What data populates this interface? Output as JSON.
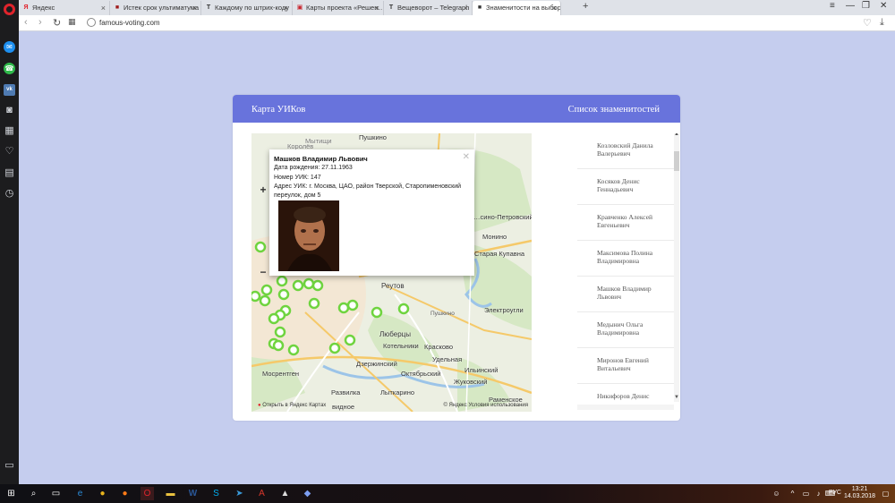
{
  "browser": {
    "tabs": [
      {
        "label": "Яндекс",
        "icon": "yandex-favicon",
        "icon_glyph": "Я",
        "color": "#e0242c"
      },
      {
        "label": "Истек срок ультиматумa",
        "icon": "news-favicon",
        "icon_glyph": "■",
        "color": "#a01c1c"
      },
      {
        "label": "Каждому по штрих-коду",
        "icon": "telegraph-favicon",
        "icon_glyph": "T",
        "color": "#222222"
      },
      {
        "label": "Карты проекта «Решен…",
        "icon": "project-favicon",
        "icon_glyph": "▣",
        "color": "#c8232c"
      },
      {
        "label": "Вещеворот – Telegraph",
        "icon": "telegraph-favicon",
        "icon_glyph": "T",
        "color": "#222222"
      },
      {
        "label": "Знаменитости на выбор…",
        "icon": "page-favicon",
        "icon_glyph": "■",
        "color": "#333333"
      }
    ],
    "url": "famous-voting.com"
  },
  "card": {
    "tab_map": "Карта УИКов",
    "tab_list": "Список знаменитостей",
    "accent": "#6873dc"
  },
  "map": {
    "labels": [
      "Пушкино",
      "Королёв",
      "Мытищи",
      "…сино-Петровский",
      "Монино",
      "Старая Купавна",
      "Реутов",
      "Пушкино",
      "Электроугли",
      "Люберцы",
      "Котельники",
      "Красково",
      "Удельная",
      "Мосрентген",
      "Дзержинский",
      "Октябрьский",
      "Ильинский",
      "Жуковский",
      "Развилка",
      "Лыткарино",
      "Раменское",
      "видное"
    ],
    "footer_left": "Открыть в Яндекс Картах",
    "footer_right": "© Яндекс Условия использования"
  },
  "popup": {
    "name": "Машков Владимир Львович",
    "birth": "Дата рождения: 27.11.1963",
    "uik": "Номер УИК: 147",
    "address_1": "Адрес УИК: г. Москва, ЦАО, район Тверской, Старопименовский",
    "address_2": "переулок, дом 5"
  },
  "celebrities": [
    {
      "line1": "Козловский Данила",
      "line2": "Валерьевич"
    },
    {
      "line1": "Косяков Денис",
      "line2": "Геннадьевич"
    },
    {
      "line1": "Кравченко Алексей",
      "line2": "Евгеньевич"
    },
    {
      "line1": "Максимова Полина",
      "line2": "Владимировна"
    },
    {
      "line1": "Машков Владимир",
      "line2": "Львович"
    },
    {
      "line1": "Медынич Ольга",
      "line2": "Владимировна"
    },
    {
      "line1": "Миронов Евгений",
      "line2": "Витальевич"
    },
    {
      "line1": "Никифоров Денис",
      "line2": ""
    }
  ],
  "taskbar": {
    "lang": "РУС",
    "time": "13:21",
    "date": "14.03.2018"
  }
}
